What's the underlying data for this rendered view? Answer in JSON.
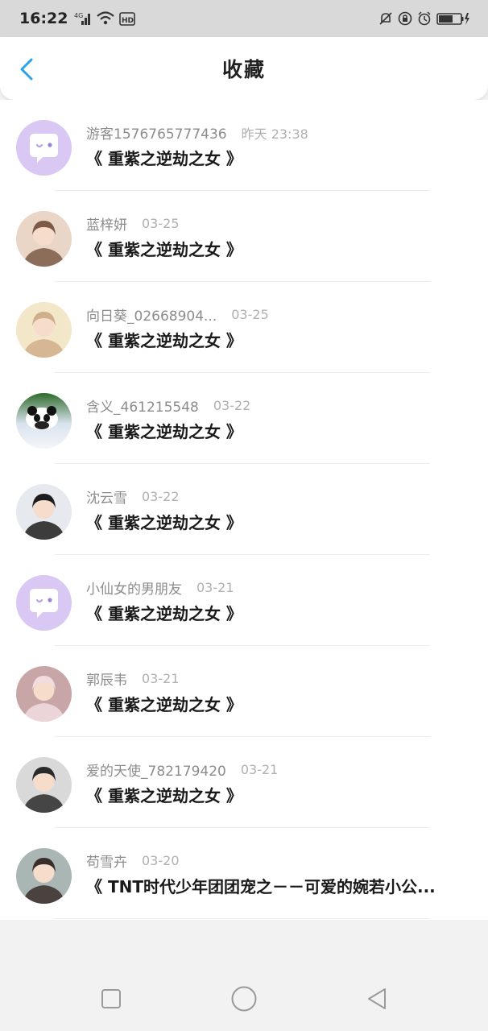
{
  "status_bar": {
    "time": "16:22",
    "net": "4G",
    "hd": "HD"
  },
  "header": {
    "title": "收藏"
  },
  "items": [
    {
      "name": "游客1576765777436",
      "time": "昨天 23:38",
      "title": "《 重紫之逆劫之女 》",
      "avatar": "default-chat"
    },
    {
      "name": "蓝梓妍",
      "time": "03-25",
      "title": "《 重紫之逆劫之女 》",
      "avatar": "photo"
    },
    {
      "name": "向日葵_02668904...",
      "time": "03-25",
      "title": "《 重紫之逆劫之女 》",
      "avatar": "photo"
    },
    {
      "name": "含义_461215548",
      "time": "03-22",
      "title": "《 重紫之逆劫之女 》",
      "avatar": "panda"
    },
    {
      "name": "沈云雪",
      "time": "03-22",
      "title": "《 重紫之逆劫之女 》",
      "avatar": "photo"
    },
    {
      "name": "小仙女的男朋友",
      "time": "03-21",
      "title": "《 重紫之逆劫之女 》",
      "avatar": "default-chat"
    },
    {
      "name": "郭辰韦",
      "time": "03-21",
      "title": "《 重紫之逆劫之女 》",
      "avatar": "photo"
    },
    {
      "name": "爱的天使_782179420",
      "time": "03-21",
      "title": "《 重紫之逆劫之女 》",
      "avatar": "photo"
    },
    {
      "name": "苟雪卉",
      "time": "03-20",
      "title": "《 TNT时代少年团团宠之－－可爱的婉若小公...",
      "avatar": "photo"
    }
  ],
  "colors": {
    "accent": "#2aa3e6",
    "default_avatar": "#d9c8f4"
  }
}
